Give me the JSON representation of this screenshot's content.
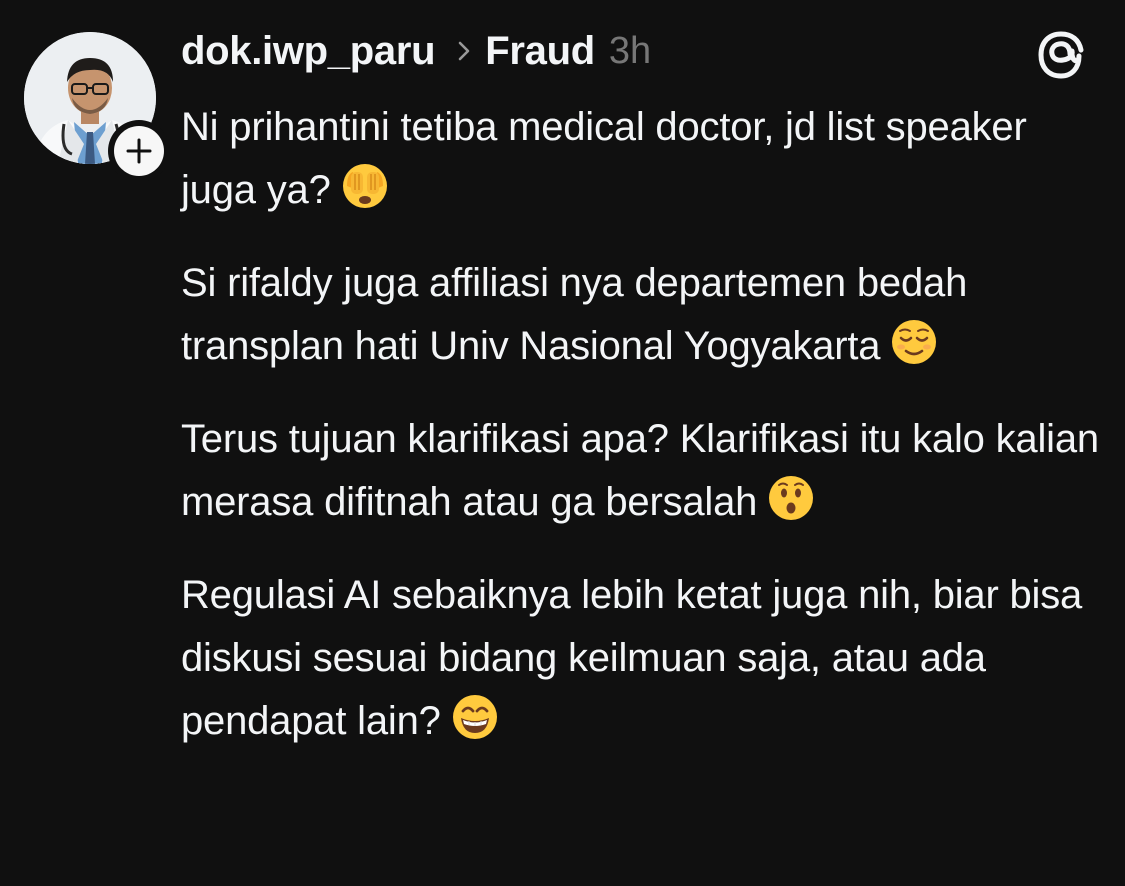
{
  "post": {
    "username": "dok.iwp_paru",
    "topic": "Fraud",
    "time": "3h",
    "paragraphs": [
      {
        "text": "Ni prihantini tetiba medical doctor, jd list speaker juga ya?",
        "emoji": "face-with-hand-over-eyes"
      },
      {
        "text": "Si rifaldy juga affiliasi nya departemen bedah transplan hati Univ Nasional Yogyakarta",
        "emoji": "relieved-face"
      },
      {
        "text": "Terus tujuan klarifikasi apa? Klarifikasi itu kalo kalian merasa difitnah atau ga bersalah",
        "emoji": "hushed-face"
      },
      {
        "text": "Regulasi AI sebaiknya lebih ketat juga nih, biar bisa diskusi sesuai bidang keilmuan saja, atau ada pendapat lain?",
        "emoji": "grinning-face"
      }
    ]
  },
  "icons": {
    "avatar": "doctor-avatar",
    "follow": "plus-icon",
    "separator": "chevron-right-icon",
    "app": "threads-logo-icon"
  },
  "colors": {
    "background": "#101010",
    "text": "#f3f5f7",
    "muted": "#777777",
    "emoji_yellow": "#ffca3e"
  }
}
